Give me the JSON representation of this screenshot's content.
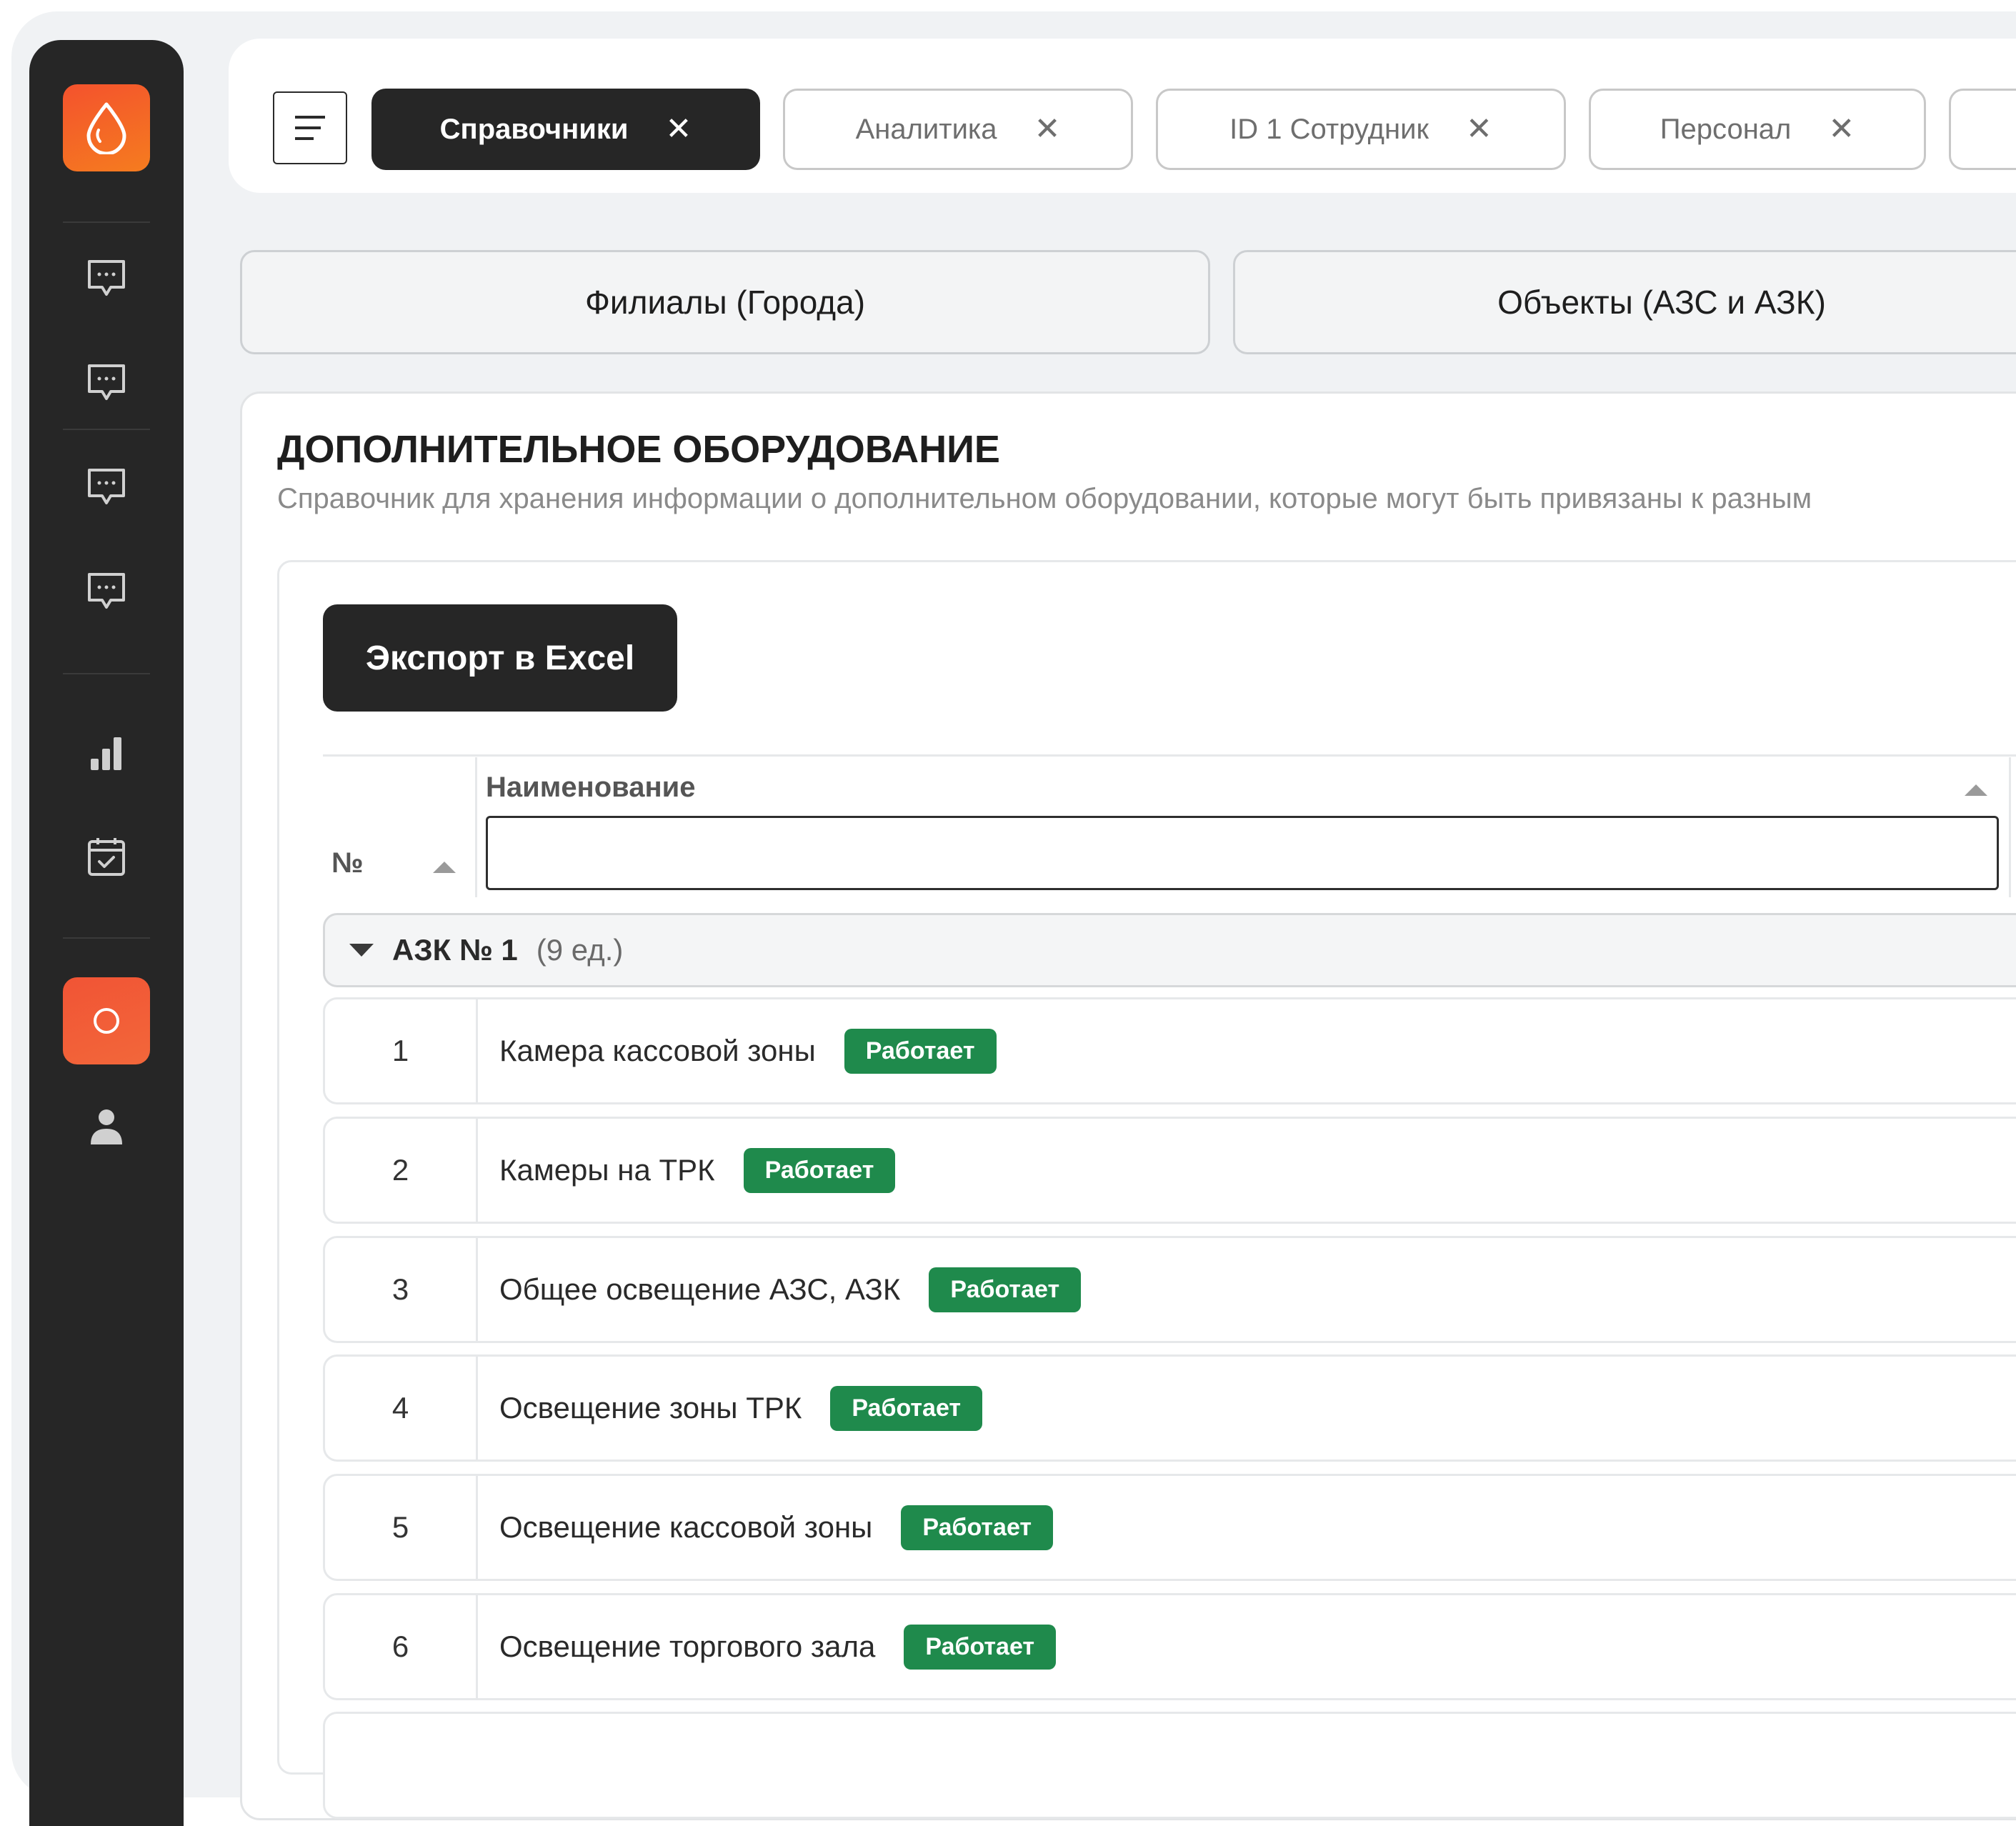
{
  "tabs": [
    {
      "label": "Справочники",
      "active": true
    },
    {
      "label": "Аналитика",
      "active": false
    },
    {
      "label": "ID 1 Сотрудник",
      "active": false
    },
    {
      "label": "Персонал",
      "active": false
    }
  ],
  "tab_close_glyph": "✕",
  "sections": [
    {
      "label": "Филиалы (Города)"
    },
    {
      "label": "Объекты (АЗС и АЗК)"
    }
  ],
  "page": {
    "title": "ДОПОЛНИТЕЛЬНОЕ ОБОРУДОВАНИЕ",
    "description": "Справочник для хранения информации о дополнительном оборудовании, которые могут быть привязаны к разным"
  },
  "toolbar": {
    "export_label": "Экспорт в Excel"
  },
  "table": {
    "columns": [
      {
        "label": "№"
      },
      {
        "label": "Наименование"
      }
    ],
    "filter_value": "",
    "group": {
      "label": "АЗК № 1",
      "count": "(9 ед.)"
    },
    "rows": [
      {
        "num": "1",
        "name": "Камера кассовой зоны",
        "status": "Работает"
      },
      {
        "num": "2",
        "name": "Камеры на ТРК",
        "status": "Работает"
      },
      {
        "num": "3",
        "name": "Общее освещение АЗС, АЗК",
        "status": "Работает"
      },
      {
        "num": "4",
        "name": "Освещение зоны ТРК",
        "status": "Работает"
      },
      {
        "num": "5",
        "name": "Освещение кассовой зоны",
        "status": "Работает"
      },
      {
        "num": "6",
        "name": "Освещение торгового зала",
        "status": "Работает"
      }
    ]
  },
  "sidebar": {
    "icons": [
      "logo-drop-icon",
      "chat-icon",
      "chat-icon",
      "chat-icon",
      "chat-icon",
      "bar-chart-icon",
      "calendar-check-icon",
      "circle-icon",
      "user-icon"
    ]
  },
  "colors": {
    "accent": "#f4522d",
    "dark": "#262626",
    "status_ok": "#1f8a4c"
  }
}
